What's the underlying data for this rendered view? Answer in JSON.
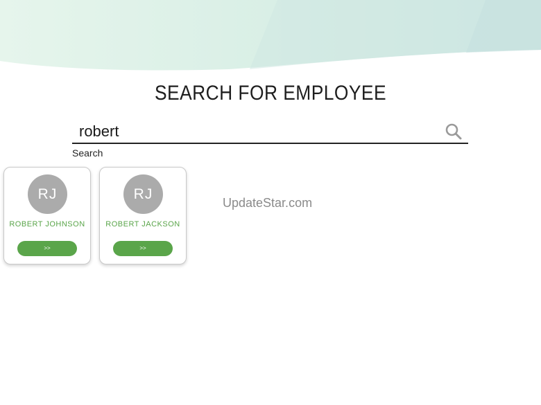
{
  "page": {
    "title": "SEARCH FOR EMPLOYEE"
  },
  "search": {
    "value": "robert",
    "label": "Search",
    "icon": "search-icon"
  },
  "results": [
    {
      "initials": "RJ",
      "name": "ROBERT JOHNSON",
      "button_label": ">>"
    },
    {
      "initials": "RJ",
      "name": "ROBERT JACKSON",
      "button_label": ">>"
    }
  ],
  "watermark": "UpdateStar.com",
  "colors": {
    "accent_green": "#5aa54a",
    "avatar_gray": "#ababab",
    "banner_light": "#e4f3ea",
    "banner_teal": "#c9e4e3"
  }
}
